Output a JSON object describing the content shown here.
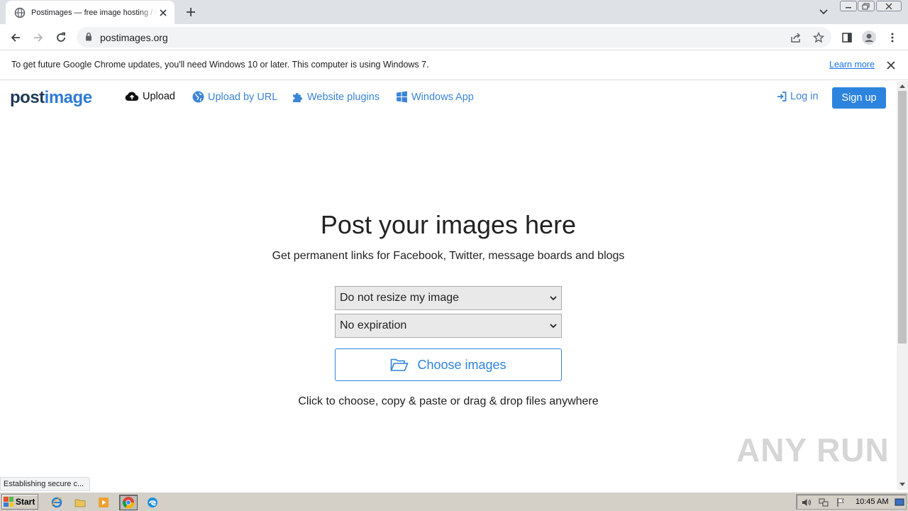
{
  "browser": {
    "tab_title": "Postimages — free image hosting / image upload",
    "url": "postimages.org"
  },
  "infobar": {
    "message": "To get future Google Chrome updates, you'll need Windows 10 or later. This computer is using Windows 7.",
    "learn_more": "Learn more"
  },
  "site": {
    "logo_part1": "post",
    "logo_part2": "image",
    "nav": {
      "upload": "Upload",
      "upload_by_url": "Upload by URL",
      "website_plugins": "Website plugins",
      "windows_app": "Windows App",
      "log_in": "Log in",
      "sign_up": "Sign up"
    },
    "hero_title": "Post your images here",
    "hero_subtitle": "Get permanent links for Facebook, Twitter, message boards and blogs",
    "resize_select": "Do not resize my image",
    "expiration_select": "No expiration",
    "choose_button": "Choose images",
    "hint": "Click to choose, copy & paste or drag & drop files anywhere",
    "accent_color": "#2d84de"
  },
  "status_text": "Establishing secure c...",
  "watermark": "ANY RUN",
  "taskbar": {
    "start_label": "Start",
    "clock": "10:45 AM"
  }
}
